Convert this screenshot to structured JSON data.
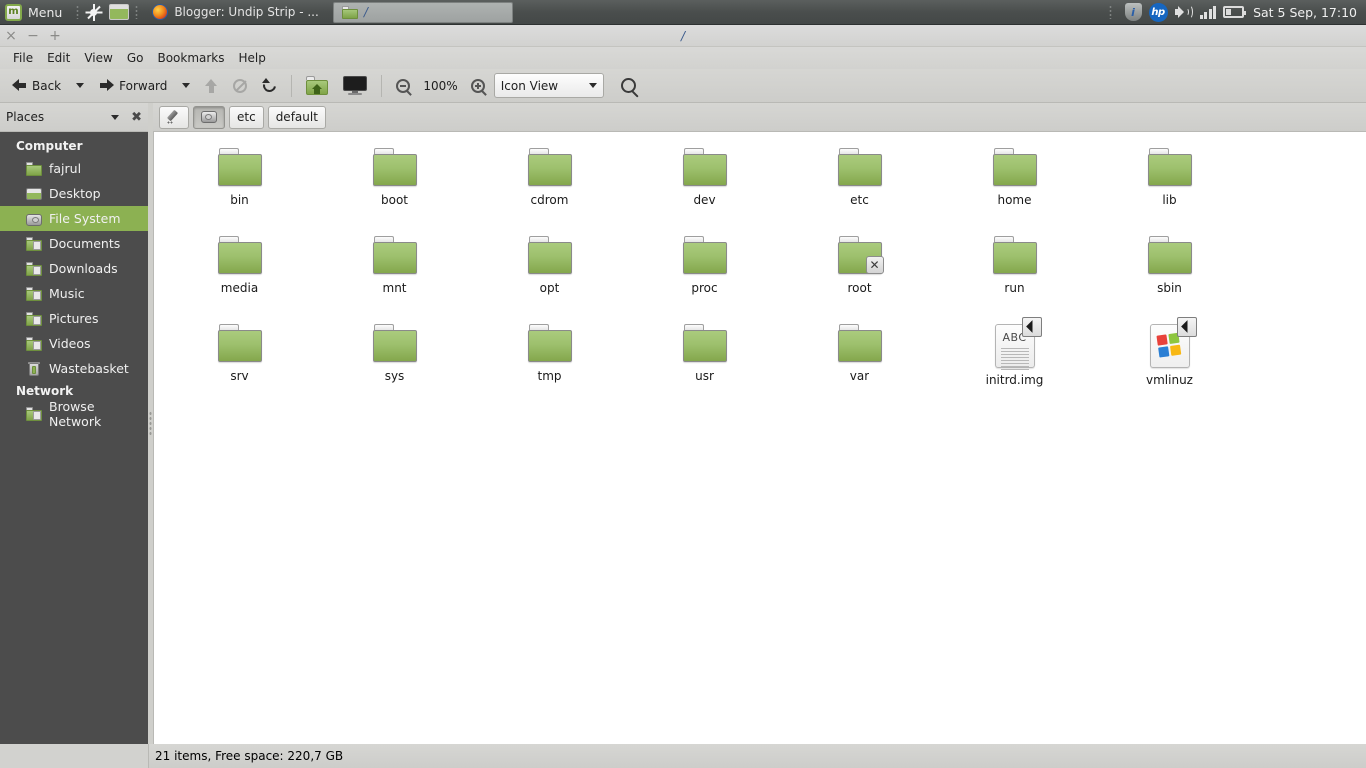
{
  "panel": {
    "menu_label": "Menu",
    "menu_icon": "linux-mint-logo-icon",
    "brightness_icon": "sun-icon",
    "show_desktop_icon": "show-desktop-icon",
    "tasks": [
      {
        "label": "Blogger: Undip Strip - ...",
        "icon": "firefox-icon",
        "active": false
      },
      {
        "label": "/",
        "icon": "folder-icon",
        "active": true
      }
    ],
    "tray": {
      "info_icon": "info-shield-icon",
      "hp_label": "hp",
      "hp_icon": "hp-logo-icon",
      "volume_icon": "speaker-icon",
      "signal_icon": "signal-bars-icon",
      "battery_icon": "battery-icon",
      "clock": "Sat  5 Sep, 17:10"
    }
  },
  "window": {
    "title": "/",
    "controls": {
      "close": "×",
      "minimize": "−",
      "new_tab": "+"
    },
    "menubar": [
      "File",
      "Edit",
      "View",
      "Go",
      "Bookmarks",
      "Help"
    ],
    "toolbar": {
      "back_label": "Back",
      "forward_label": "Forward",
      "up_icon": "up-arrow-icon",
      "stop_icon": "stop-icon",
      "reload_icon": "reload-icon",
      "home_icon": "home-folder-icon",
      "computer_icon": "computer-monitor-icon",
      "zoom_out_icon": "zoom-out-icon",
      "zoom_level": "100%",
      "zoom_in_icon": "zoom-in-icon",
      "view_mode": "Icon View",
      "search_icon": "search-icon"
    }
  },
  "sidebar": {
    "header_title": "Places",
    "header_menu_icon": "chevron-down-icon",
    "header_close_icon": "close-icon",
    "groups": [
      {
        "title": "Computer",
        "items": [
          {
            "label": "fajrul",
            "icon": "home-folder-icon",
            "selected": false
          },
          {
            "label": "Desktop",
            "icon": "desktop-icon",
            "selected": false
          },
          {
            "label": "File System",
            "icon": "harddisk-icon",
            "selected": true
          },
          {
            "label": "Documents",
            "icon": "documents-folder-icon",
            "selected": false
          },
          {
            "label": "Downloads",
            "icon": "downloads-folder-icon",
            "selected": false
          },
          {
            "label": "Music",
            "icon": "music-folder-icon",
            "selected": false
          },
          {
            "label": "Pictures",
            "icon": "pictures-folder-icon",
            "selected": false
          },
          {
            "label": "Videos",
            "icon": "videos-folder-icon",
            "selected": false
          },
          {
            "label": "Wastebasket",
            "icon": "trash-icon",
            "selected": false
          }
        ]
      },
      {
        "title": "Network",
        "items": [
          {
            "label": "Browse Network",
            "icon": "network-folder-icon",
            "selected": false
          }
        ]
      }
    ]
  },
  "breadcrumb": {
    "edit_path_icon": "pencil-icon",
    "crumbs": [
      {
        "label": "",
        "icon": "harddisk-icon",
        "active": true
      },
      {
        "label": "etc",
        "icon": "",
        "active": false
      },
      {
        "label": "default",
        "icon": "",
        "active": false
      }
    ]
  },
  "files": [
    {
      "name": "bin",
      "type": "folder"
    },
    {
      "name": "boot",
      "type": "folder"
    },
    {
      "name": "cdrom",
      "type": "folder"
    },
    {
      "name": "dev",
      "type": "folder"
    },
    {
      "name": "etc",
      "type": "folder"
    },
    {
      "name": "home",
      "type": "folder"
    },
    {
      "name": "lib",
      "type": "folder"
    },
    {
      "name": "media",
      "type": "folder"
    },
    {
      "name": "mnt",
      "type": "folder"
    },
    {
      "name": "opt",
      "type": "folder"
    },
    {
      "name": "proc",
      "type": "folder"
    },
    {
      "name": "root",
      "type": "folder",
      "emblem": "no-access-x"
    },
    {
      "name": "run",
      "type": "folder"
    },
    {
      "name": "sbin",
      "type": "folder"
    },
    {
      "name": "srv",
      "type": "folder"
    },
    {
      "name": "sys",
      "type": "folder"
    },
    {
      "name": "tmp",
      "type": "folder"
    },
    {
      "name": "usr",
      "type": "folder"
    },
    {
      "name": "var",
      "type": "folder"
    },
    {
      "name": "initrd.img",
      "type": "document",
      "doc_text": "ABC",
      "emblem": "symlink-arrow"
    },
    {
      "name": "vmlinuz",
      "type": "windows",
      "emblem": "symlink-arrow"
    }
  ],
  "statusbar": {
    "text": "21 items, Free space: 220,7 GB"
  },
  "colors": {
    "panel_bg": "#4a4e4d",
    "sidebar_bg": "#4c4c4c",
    "selection_green": "#8cb152",
    "folder_green_top": "#aacb7d",
    "folder_green_bottom": "#84a74c",
    "window_chrome": "#d2d2cf",
    "title_text": "#3a5a8c"
  }
}
